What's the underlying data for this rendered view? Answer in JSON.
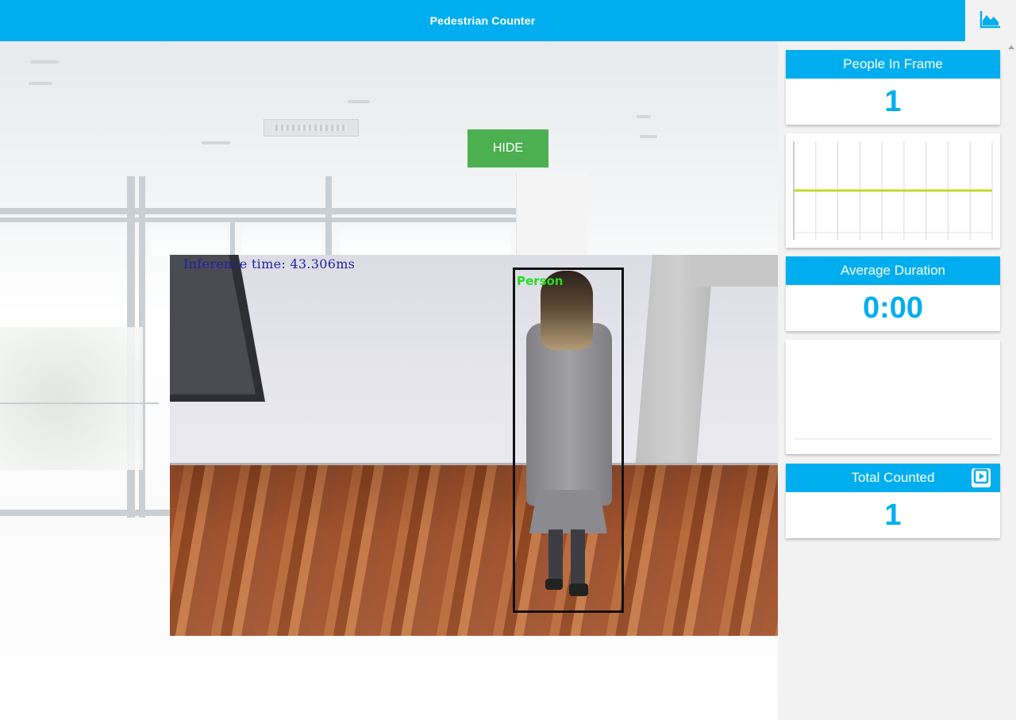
{
  "header": {
    "title": "Pedestrian Counter",
    "stats_icon": "area-chart-icon"
  },
  "video": {
    "hide_label": "HIDE",
    "inference_text": "Inference time: 43.306ms",
    "detection_label": "Person"
  },
  "stats": {
    "people_in_frame": {
      "label": "People In Frame",
      "value": "1"
    },
    "average_duration": {
      "label": "Average Duration",
      "value": "0:00"
    },
    "total_counted": {
      "label": "Total Counted",
      "value": "1",
      "icon": "play-square-icon"
    }
  },
  "colors": {
    "accent": "#00aeef",
    "hide_button": "#4caf50",
    "line_series": "#c3d82c",
    "bbox_label": "#22dd22"
  },
  "chart_data": [
    {
      "type": "line",
      "title": "",
      "xlabel": "",
      "ylabel": "",
      "series": [
        {
          "values": [
            1,
            1,
            1,
            1,
            1,
            1,
            1,
            1,
            1,
            1
          ]
        }
      ],
      "ylim": [
        0,
        2
      ],
      "grid": "vertical"
    },
    {
      "type": "line",
      "title": "",
      "xlabel": "",
      "ylabel": "",
      "series": [],
      "grid": "none"
    }
  ]
}
